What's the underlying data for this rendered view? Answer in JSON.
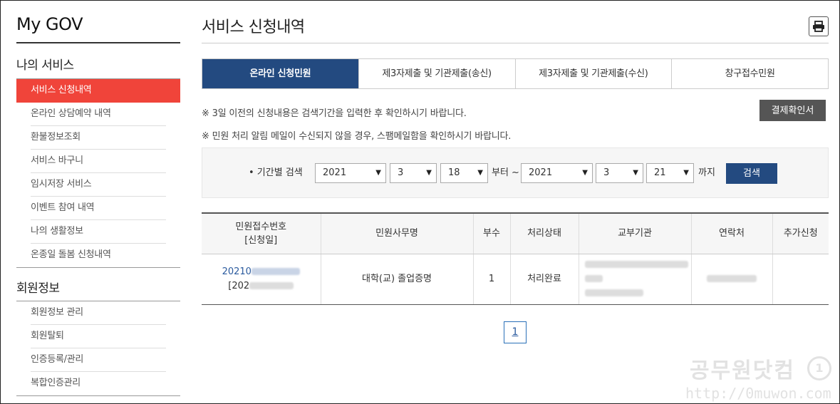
{
  "sidebar": {
    "logo": "My GOV",
    "my_services_title": "나의 서비스",
    "my_services": [
      {
        "label": "서비스 신청내역",
        "active": true
      },
      {
        "label": "온라인 상담예약 내역"
      },
      {
        "label": "환불정보조회"
      },
      {
        "label": "서비스 바구니"
      },
      {
        "label": "임시저장 서비스"
      },
      {
        "label": "이벤트 참여 내역"
      },
      {
        "label": "나의 생활정보"
      },
      {
        "label": "온종일 돌봄 신청내역"
      }
    ],
    "member_title": "회원정보",
    "member_items": [
      {
        "label": "회원정보 관리"
      },
      {
        "label": "회원탈퇴"
      },
      {
        "label": "인증등록/관리"
      },
      {
        "label": "복합인증관리"
      }
    ]
  },
  "header": {
    "title": "서비스 신청내역",
    "print_icon": "printer-icon"
  },
  "tabs": [
    {
      "label": "온라인 신청민원",
      "active": true
    },
    {
      "label": "제3자제출 및 기관제출(송신)"
    },
    {
      "label": "제3자제출 및 기관제출(수신)"
    },
    {
      "label": "창구접수민원"
    }
  ],
  "notices": {
    "line1": "※ 3일 이전의 신청내용은 검색기간을 입력한 후 확인하시기 바랍니다.",
    "line2": "※ 민원 처리 알림 메일이 수신되지 않을 경우, 스팸메일함을 확인하시기 바랍니다.",
    "receipt_button": "결제확인서"
  },
  "search": {
    "label": "• 기간별 검색",
    "from_year": "2021",
    "from_month": "3",
    "from_day": "18",
    "from_text": "부터 ~",
    "to_year": "2021",
    "to_month": "3",
    "to_day": "21",
    "to_text": "까지",
    "button": "검색"
  },
  "table": {
    "headers": [
      "민원접수번호",
      "[신청일]",
      "민원사무명",
      "부수",
      "처리상태",
      "교부기관",
      "연락처",
      "추가신청"
    ],
    "rows": [
      {
        "receipt_no": "20210",
        "date": "[202",
        "service_name": "대학(교) 졸업증명",
        "copies": "1",
        "status": "처리완료",
        "agency": "",
        "contact": "",
        "extra": ""
      }
    ]
  },
  "pagination": {
    "current": "1"
  },
  "watermark": {
    "text": "공무원닷컴",
    "url": "http://0muwon.com",
    "badge": "1"
  }
}
